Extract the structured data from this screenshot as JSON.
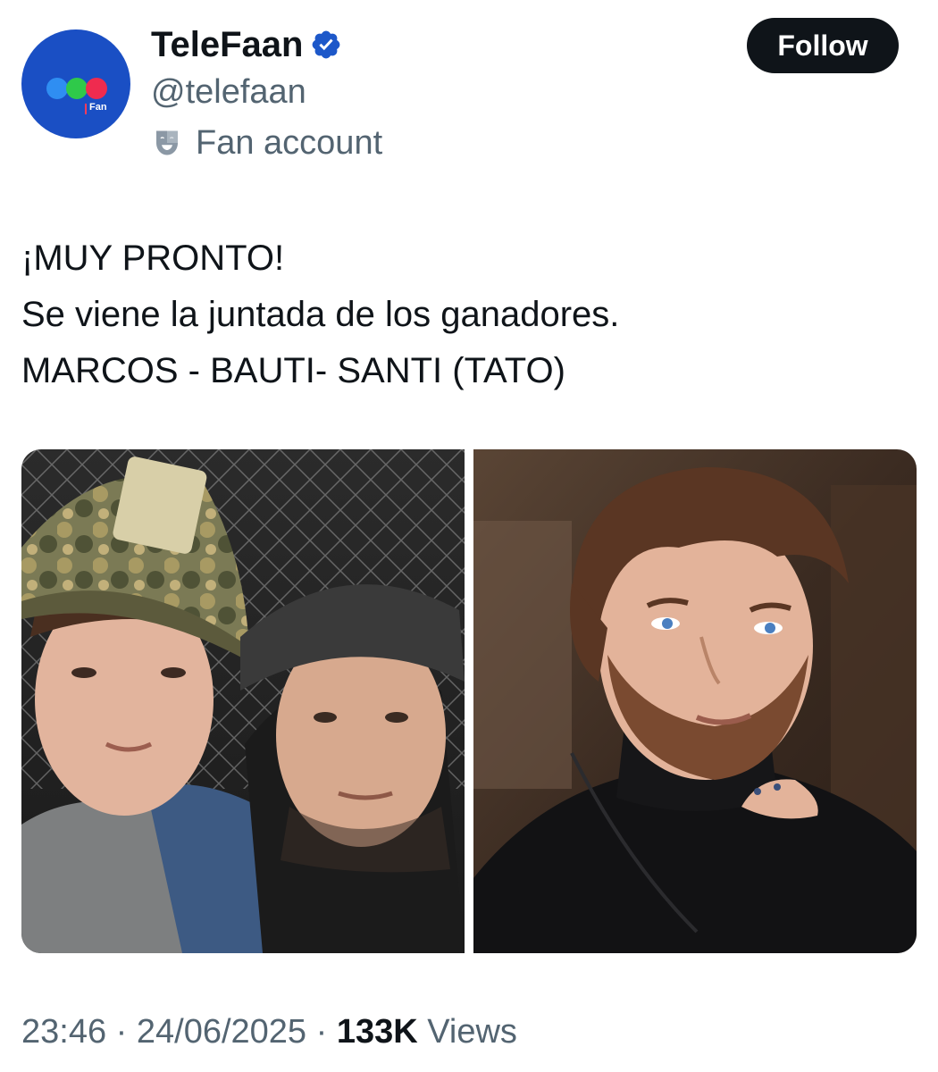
{
  "author": {
    "display_name": "TeleFaan",
    "handle": "@telefaan",
    "affiliation_label": "Fan account",
    "avatar_text": "Fan",
    "verified_icon": "verified-badge-icon",
    "affiliation_icon": "theater-mask-icon"
  },
  "actions": {
    "follow_label": "Follow"
  },
  "tweet": {
    "lines": [
      "¡MUY PRONTO!",
      "Se viene la juntada de los ganadores.",
      "MARCOS - BAUTI- SANTI (TATO)"
    ]
  },
  "media": {
    "count": 2
  },
  "meta": {
    "time": "23:46",
    "separator": "·",
    "date": "24/06/2025",
    "views_count": "133K",
    "views_label": "Views"
  },
  "colors": {
    "text_primary": "#0f1419",
    "text_secondary": "#536471",
    "verified": "#1d58c9",
    "avatar_bg": "#1a4fc4",
    "button_bg": "#0f1419"
  }
}
